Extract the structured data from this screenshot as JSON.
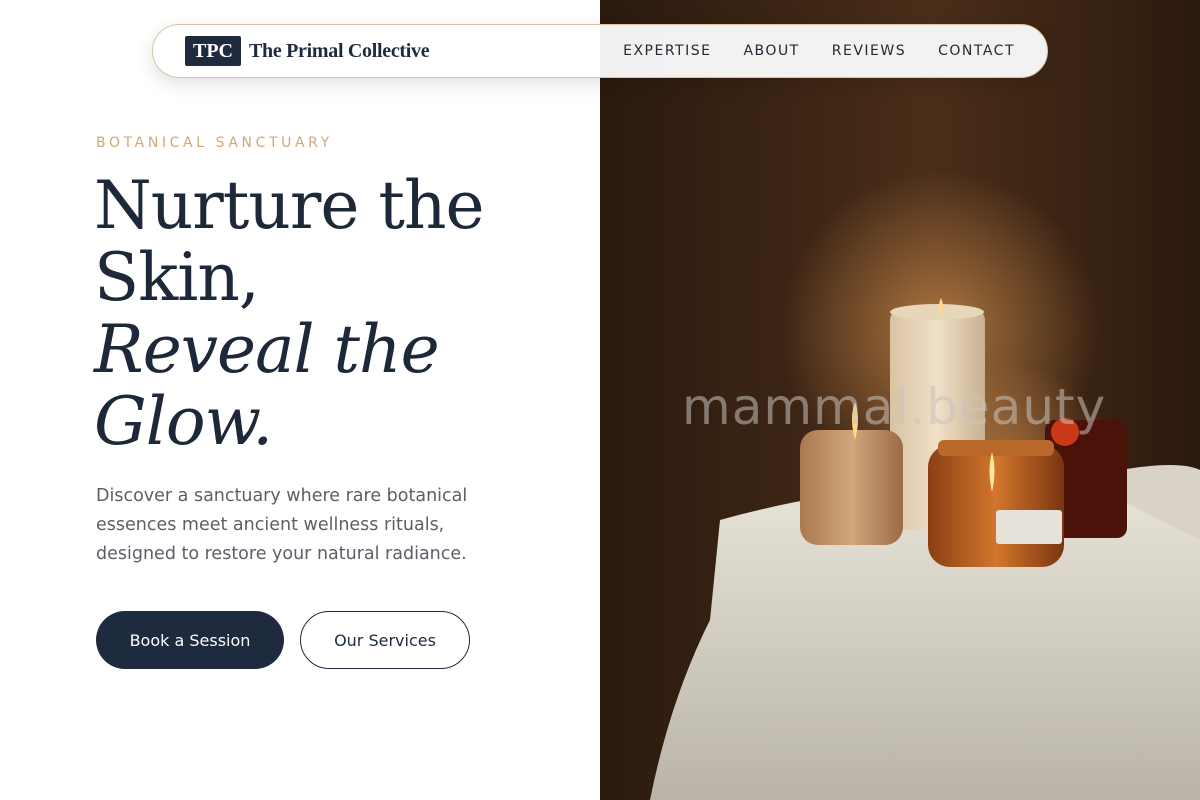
{
  "brand": {
    "badge": "TPC",
    "name": "The Primal Collective"
  },
  "nav": {
    "items": [
      {
        "label": "EXPERTISE"
      },
      {
        "label": "ABOUT"
      },
      {
        "label": "REVIEWS"
      },
      {
        "label": "CONTACT"
      }
    ]
  },
  "hero": {
    "eyebrow": "BOTANICAL SANCTUARY",
    "headline_line1": "Nurture the",
    "headline_line2": "Skin,",
    "headline_line3": "Reveal the",
    "headline_line4": "Glow.",
    "lead": "Discover a sanctuary where rare botanical essences meet ancient wellness rituals, designed to restore your natural radiance.",
    "primary_cta": "Book a Session",
    "secondary_cta": "Our Services"
  },
  "image": {
    "watermark": "mammal.beauty",
    "description_icon": "candles-photo"
  },
  "colors": {
    "navy": "#1e2a3d",
    "accent_gold": "#cfa87b",
    "body_text": "#5a5f68"
  }
}
